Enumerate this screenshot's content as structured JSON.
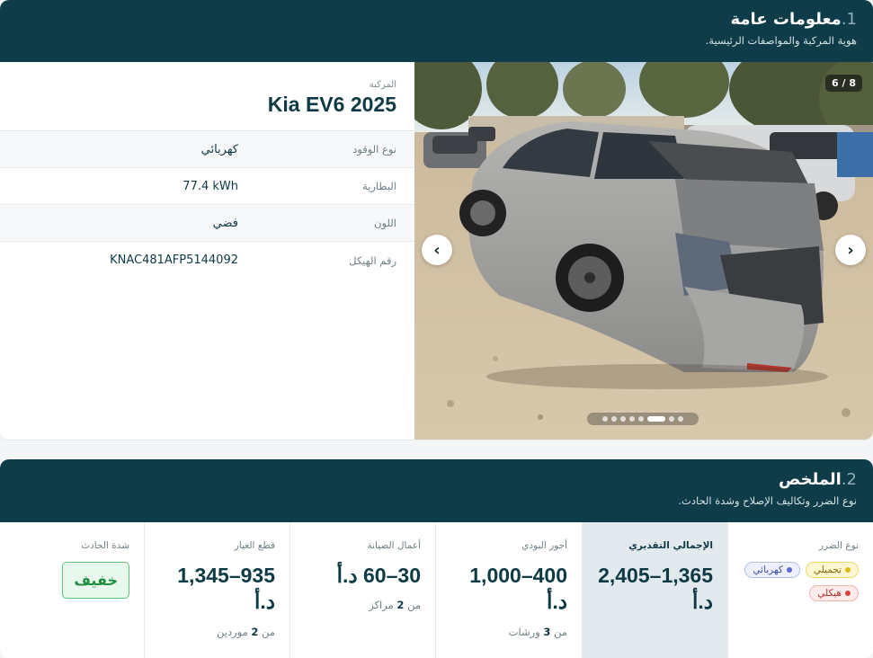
{
  "section1": {
    "number": "1.",
    "title": "معلومات عامة",
    "subtitle": "هوية المركبة والمواصفات الرئيسية."
  },
  "vehicle": {
    "label": "المركبة",
    "model": "Kia EV6 2025",
    "rows": [
      {
        "key": "نوع الوقود",
        "value": "كهربائي"
      },
      {
        "key": "البطارية",
        "value": "77.4 kWh"
      },
      {
        "key": "اللون",
        "value": "فضي"
      },
      {
        "key": "رقم الهيكل",
        "value": "KNAC481AFP5144092"
      }
    ]
  },
  "gallery": {
    "counter": "6 / 8",
    "total": 8,
    "current": 6,
    "prev_icon": "chevron-left-icon",
    "next_icon": "chevron-right-icon"
  },
  "section2": {
    "number": "2.",
    "title": "الملخص",
    "subtitle": "نوع الضرر وتكاليف الإصلاح وشدة الحادث."
  },
  "summary": {
    "damage_type": {
      "label": "نوع الضرر",
      "tags": [
        {
          "text": "تجميلي",
          "color": "yellow"
        },
        {
          "text": "كهربائي",
          "color": "blue"
        },
        {
          "text": "هيكلي",
          "color": "red"
        }
      ]
    },
    "total": {
      "label": "الإجمالي التقديري",
      "value": "1,365–2,405 د.أ"
    },
    "body_labor": {
      "label": "أجور البودي",
      "value": "400–1,000 د.أ",
      "note_prefix": "من",
      "note_count": "3",
      "note_suffix": "ورشات"
    },
    "maintenance": {
      "label": "أعمال الصيانة",
      "value": "30–60 د.أ",
      "note_prefix": "من",
      "note_count": "2",
      "note_suffix": "مراكز"
    },
    "parts": {
      "label": "قطع الغيار",
      "value": "935–1,345 د.أ",
      "note_prefix": "من",
      "note_count": "2",
      "note_suffix": "موردين"
    },
    "severity": {
      "label": "شدة الحادث",
      "value": "خفيف",
      "color": "#1e8f3f"
    }
  },
  "colors": {
    "header_bg": "#0e3d49",
    "accent_muted": "#8fb0b8",
    "highlight_col": "#e3eaed"
  }
}
